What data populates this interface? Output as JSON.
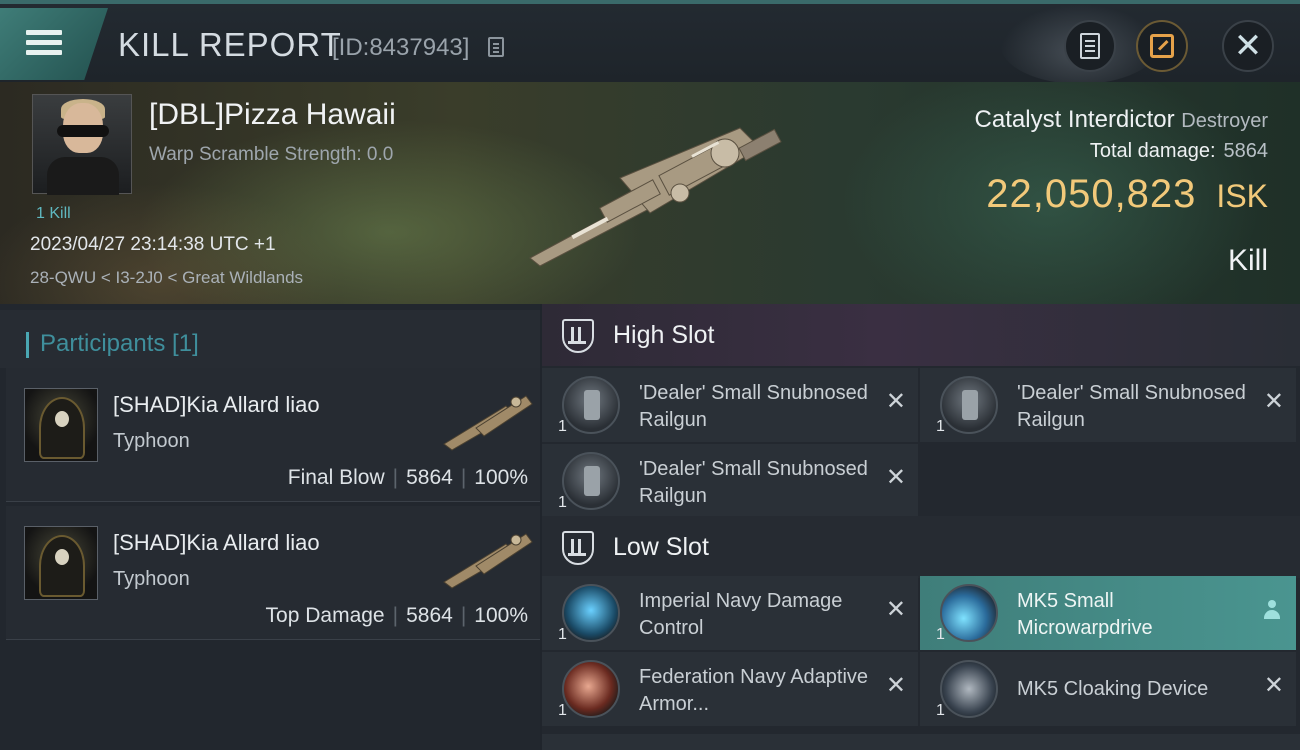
{
  "header": {
    "title": "KILL REPORT",
    "report_id": "[ID:8437943]"
  },
  "victim": {
    "name": "[DBL]Pizza Hawaii",
    "warp_scramble": "Warp Scramble Strength: 0.0",
    "kill_count": "1 Kill",
    "datetime": "2023/04/27 23:14:38 UTC +1",
    "location": "28-QWU < I3-2J0 < Great Wildlands",
    "ship_name": "Catalyst Interdictor",
    "ship_class": "Destroyer",
    "total_damage_label": "Total damage:",
    "total_damage": "5864",
    "isk_value": "22,050,823",
    "isk_unit": "ISK",
    "result": "Kill"
  },
  "participants": {
    "title": "Participants [1]",
    "items": [
      {
        "name": "[SHAD]Kia Allard liao",
        "ship": "Typhoon",
        "role": "Final Blow",
        "damage": "5864",
        "percent": "100%"
      },
      {
        "name": "[SHAD]Kia Allard liao",
        "ship": "Typhoon",
        "role": "Top Damage",
        "damage": "5864",
        "percent": "100%"
      }
    ]
  },
  "fitting": {
    "high_slot": {
      "title": "High Slot",
      "modules": [
        {
          "name": "'Dealer' Small Snubnosed Railgun",
          "qty": "1",
          "icon": "railgun-icon"
        },
        {
          "name": "'Dealer' Small Snubnosed Railgun",
          "qty": "1",
          "icon": "railgun-icon"
        },
        {
          "name": "'Dealer' Small Snubnosed Railgun",
          "qty": "1",
          "icon": "railgun-icon"
        }
      ]
    },
    "low_slot": {
      "title": "Low Slot",
      "modules": [
        {
          "name": "Imperial Navy Damage Control",
          "qty": "1",
          "icon": "damage-control-icon"
        },
        {
          "name": "MK5 Small Microwarpdrive",
          "qty": "1",
          "icon": "microwarpdrive-icon",
          "active": true
        },
        {
          "name": "Federation Navy Adaptive Armor...",
          "qty": "1",
          "icon": "armor-hardener-icon"
        },
        {
          "name": "MK5 Cloaking Device",
          "qty": "1",
          "icon": "cloaking-device-icon"
        }
      ]
    },
    "remove_symbol": "✕"
  },
  "colors": {
    "accent_teal": "#4aa7b3",
    "isk_gold": "#f2c97a",
    "active_module": "#4a9590"
  }
}
